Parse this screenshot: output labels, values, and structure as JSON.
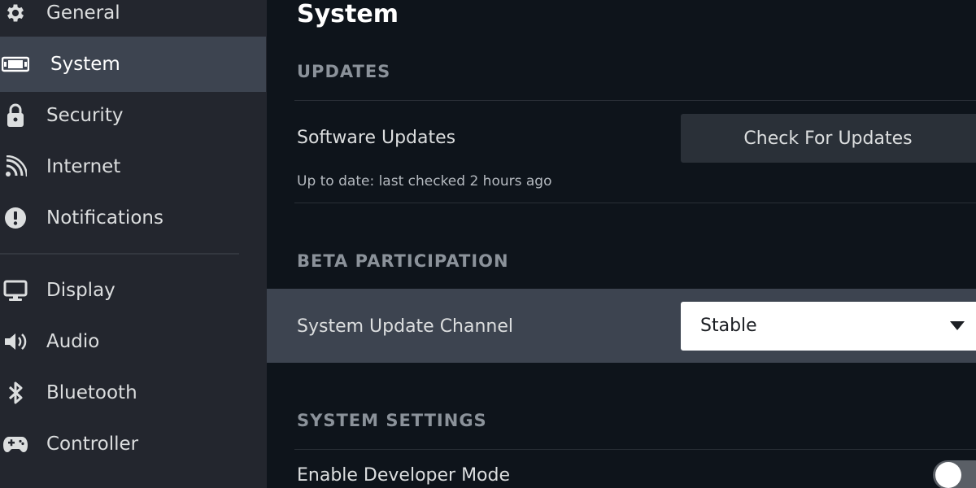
{
  "sidebar": {
    "items": [
      {
        "label": "General",
        "icon": "gear-icon",
        "active": false
      },
      {
        "label": "System",
        "icon": "system-device-icon",
        "active": true
      },
      {
        "label": "Security",
        "icon": "lock-icon",
        "active": false
      },
      {
        "label": "Internet",
        "icon": "wifi-signal-icon",
        "active": false
      },
      {
        "label": "Notifications",
        "icon": "alert-circle-icon",
        "active": false
      },
      {
        "label": "Display",
        "icon": "monitor-icon",
        "active": false
      },
      {
        "label": "Audio",
        "icon": "speaker-icon",
        "active": false
      },
      {
        "label": "Bluetooth",
        "icon": "bluetooth-icon",
        "active": false
      },
      {
        "label": "Controller",
        "icon": "gamepad-icon",
        "active": false
      }
    ]
  },
  "main": {
    "title": "System",
    "updates": {
      "header": "UPDATES",
      "software_updates_label": "Software Updates",
      "status": "Up to date: last checked 2 hours ago",
      "check_button": "Check For Updates"
    },
    "beta": {
      "header": "BETA PARTICIPATION",
      "channel_label": "System Update Channel",
      "channel_value": "Stable"
    },
    "system_settings": {
      "header": "SYSTEM SETTINGS",
      "developer_mode_label": "Enable Developer Mode",
      "developer_mode_enabled": false
    }
  },
  "colors": {
    "background": "#0e141b",
    "sidebar": "#23262e",
    "active_row": "#3d4450",
    "button": "#2a3038",
    "section_header": "#8b929a"
  }
}
